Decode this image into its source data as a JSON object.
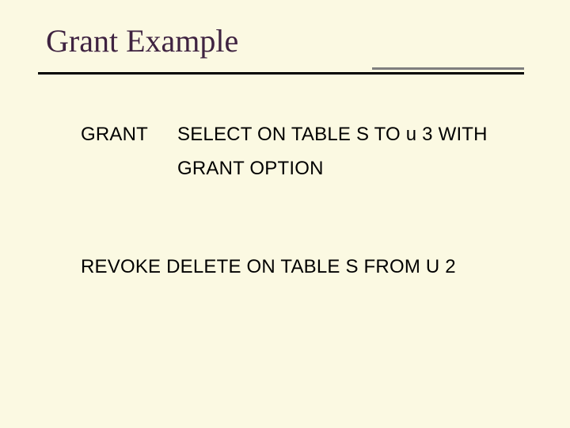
{
  "slide": {
    "title": "Grant Example",
    "grant": {
      "keyword": "GRANT",
      "line1": "SELECT  ON TABLE S TO u 3 WITH",
      "line2": "GRANT OPTION"
    },
    "revoke": {
      "text": "REVOKE DELETE ON TABLE S FROM U 2"
    }
  }
}
